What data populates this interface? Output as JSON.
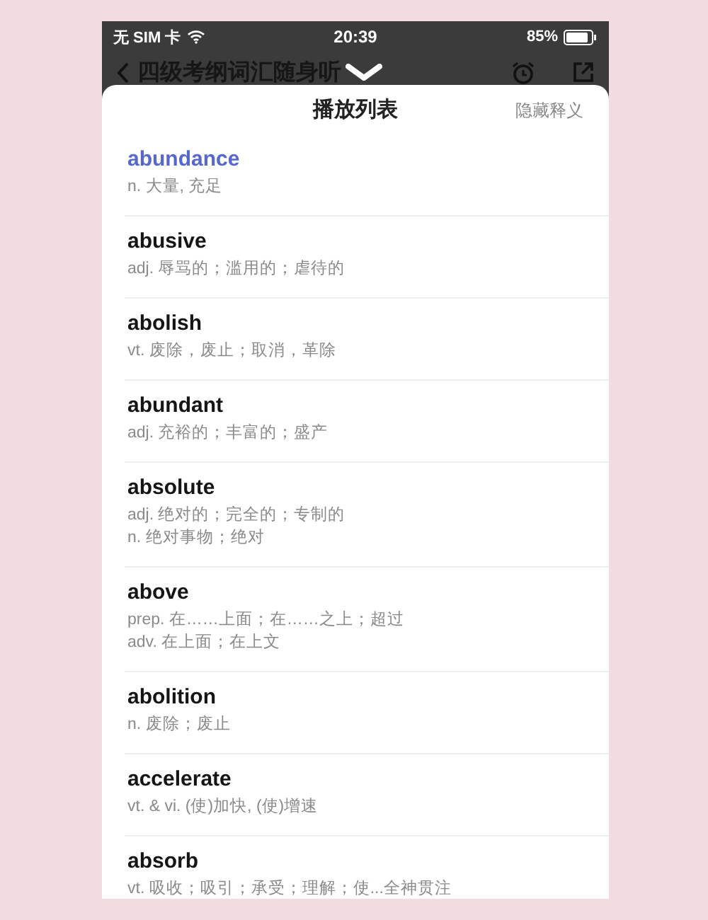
{
  "status_bar": {
    "carrier": "无 SIM 卡",
    "time": "20:39",
    "battery": "85%"
  },
  "nav_bar": {
    "title": "四级考纲词汇随身听"
  },
  "sheet": {
    "title": "播放列表",
    "action": "隐藏释义"
  },
  "words": [
    {
      "word": "abundance",
      "definition": "n. 大量, 充足",
      "selected": true
    },
    {
      "word": "abusive",
      "definition": "adj. 辱骂的；滥用的；虐待的",
      "selected": false
    },
    {
      "word": "abolish",
      "definition": "vt. 废除，废止；取消，革除",
      "selected": false
    },
    {
      "word": "abundant",
      "definition": "adj. 充裕的；丰富的；盛产",
      "selected": false
    },
    {
      "word": "absolute",
      "definition": "adj. 绝对的；完全的；专制的\nn. 绝对事物；绝对",
      "selected": false
    },
    {
      "word": "above",
      "definition": "prep. 在……上面；在……之上；超过\nadv. 在上面；在上文",
      "selected": false
    },
    {
      "word": "abolition",
      "definition": "n. 废除；废止",
      "selected": false
    },
    {
      "word": "accelerate",
      "definition": "vt. & vi. (使)加快, (使)增速",
      "selected": false
    },
    {
      "word": "absorb",
      "definition": "vt. 吸收；吸引；承受；理解；使...全神贯注",
      "selected": false
    }
  ]
}
